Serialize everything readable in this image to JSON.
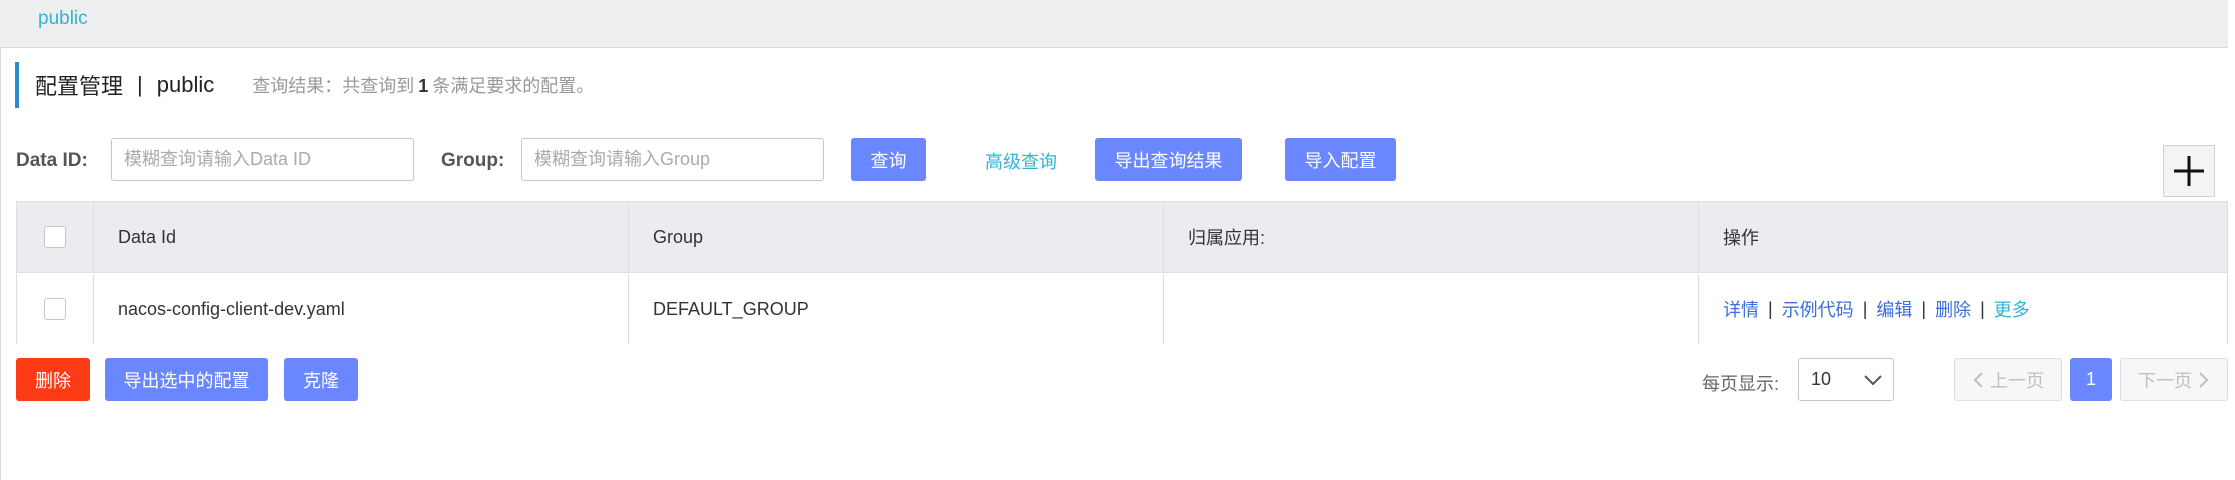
{
  "namespace_bar": {
    "active": "public"
  },
  "header": {
    "title": "配置管理",
    "separator": "|",
    "namespace": "public",
    "result_prefix": "查询结果：共查询到",
    "result_count": "1",
    "result_suffix": "条满足要求的配置。"
  },
  "search": {
    "data_id_label": "Data ID:",
    "data_id_placeholder": "模糊查询请输入Data ID",
    "group_label": "Group:",
    "group_placeholder": "模糊查询请输入Group",
    "query_button": "查询",
    "advanced_query": "高级查询",
    "export_results_button": "导出查询结果",
    "import_button": "导入配置",
    "add_icon": "plus-icon"
  },
  "table": {
    "columns": [
      "Data Id",
      "Group",
      "归属应用:",
      "操作"
    ],
    "rows": [
      {
        "data_id": "nacos-config-client-dev.yaml",
        "group": "DEFAULT_GROUP",
        "app": "",
        "actions": {
          "detail": "详情",
          "sample_code": "示例代码",
          "edit": "编辑",
          "delete": "删除",
          "more": "更多"
        }
      }
    ]
  },
  "footer": {
    "delete_button": "删除",
    "export_selected_button": "导出选中的配置",
    "clone_button": "克隆",
    "page_size_label": "每页显示:",
    "page_size": "10",
    "prev_page": "上一页",
    "current_page": "1",
    "next_page": "下一页"
  },
  "colors": {
    "primary": "#6b87ff",
    "danger": "#ff3b16",
    "link": "#2fb4d6",
    "action_link": "#3a6fd8",
    "accent_bar": "#2a8bd0"
  }
}
